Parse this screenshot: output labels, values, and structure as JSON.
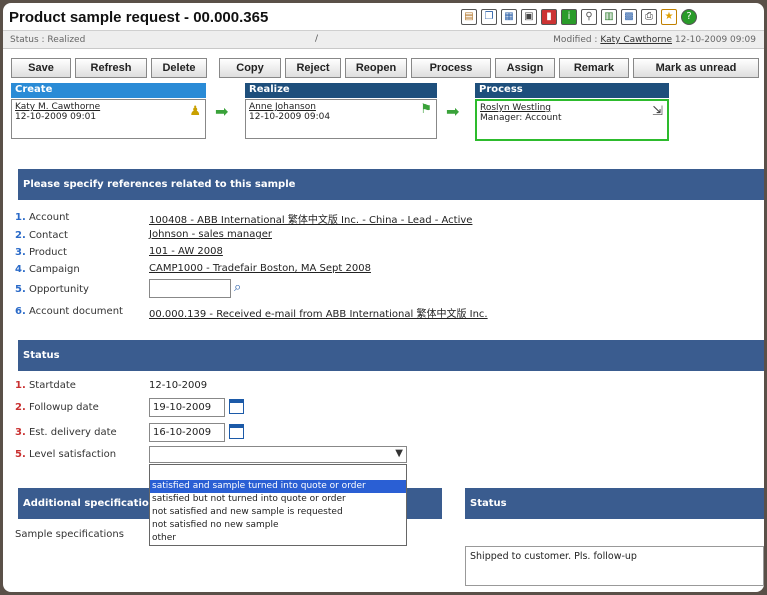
{
  "window": {
    "title": "Product sample request - 00.000.365",
    "status": "Status : Realized",
    "status_sep": "/",
    "modified_prefix": "Modified : ",
    "modified_user": "Katy Cawthorne",
    "modified_time": "12-10-2009 09:09"
  },
  "toolbar_icons": [
    "doc-icon",
    "copy-icon",
    "calendar-icon",
    "print-preview-icon",
    "book-icon",
    "info-icon",
    "tree-icon",
    "chart-icon",
    "grid-icon",
    "print-icon",
    "favorite-icon",
    "help-icon"
  ],
  "buttons": {
    "save": "Save",
    "refresh": "Refresh",
    "delete": "Delete",
    "copy": "Copy",
    "reject": "Reject",
    "reopen": "Reopen",
    "process": "Process",
    "assign": "Assign",
    "remark": "Remark",
    "mark_unread": "Mark as unread"
  },
  "workflow": {
    "create": {
      "header": "Create",
      "user": "Katy M. Cawthorne",
      "time": "12-10-2009 09:01"
    },
    "realize": {
      "header": "Realize",
      "user": "Anne Johanson",
      "time": "12-10-2009 09:04"
    },
    "process": {
      "header": "Process",
      "user": "Roslyn Westling",
      "role": "Manager: Account"
    }
  },
  "references": {
    "header": "Please specify references related to this sample",
    "fields": [
      {
        "num": "1.",
        "label": "Account",
        "value": "100408 - ABB International 繁体中文版 Inc. - China - Lead - Active"
      },
      {
        "num": "2.",
        "label": "Contact",
        "value": "Johnson - sales manager"
      },
      {
        "num": "3.",
        "label": "Product",
        "value": "101 - AW 2008"
      },
      {
        "num": "4.",
        "label": "Campaign",
        "value": "CAMP1000 - Tradefair Boston, MA Sept 2008"
      },
      {
        "num": "5.",
        "label": "Opportunity",
        "value": ""
      },
      {
        "num": "6.",
        "label": "Account document",
        "value": "00.000.139 - Received e-mail from ABB International 繁体中文版 Inc."
      }
    ]
  },
  "status_section": {
    "header": "Status",
    "fields": [
      {
        "num": "1.",
        "label": "Startdate",
        "value": "12-10-2009"
      },
      {
        "num": "2.",
        "label": "Followup date",
        "value": "19-10-2009"
      },
      {
        "num": "3.",
        "label": "Est. delivery date",
        "value": "16-10-2009"
      },
      {
        "num": "5.",
        "label": "Level satisfaction",
        "value": ""
      }
    ],
    "satisfaction_options": [
      "",
      "satisfied and sample turned into quote or order",
      "satisfied but not turned into quote or order",
      "not satisfied and new sample is requested",
      "not satisfied no new sample",
      "other"
    ]
  },
  "additional": {
    "header": "Additional specificatio",
    "sample_spec_label": "Sample specifications"
  },
  "status_panel": {
    "header": "Status",
    "text": "Shipped to customer. Pls. follow-up"
  },
  "colors": {
    "section": "#3a5c8f",
    "workflow_create": "#2a8bd6",
    "workflow_realize": "#1e4f7c",
    "active_step": "#2dbb2d",
    "selected_option": "#2a5fd4"
  }
}
